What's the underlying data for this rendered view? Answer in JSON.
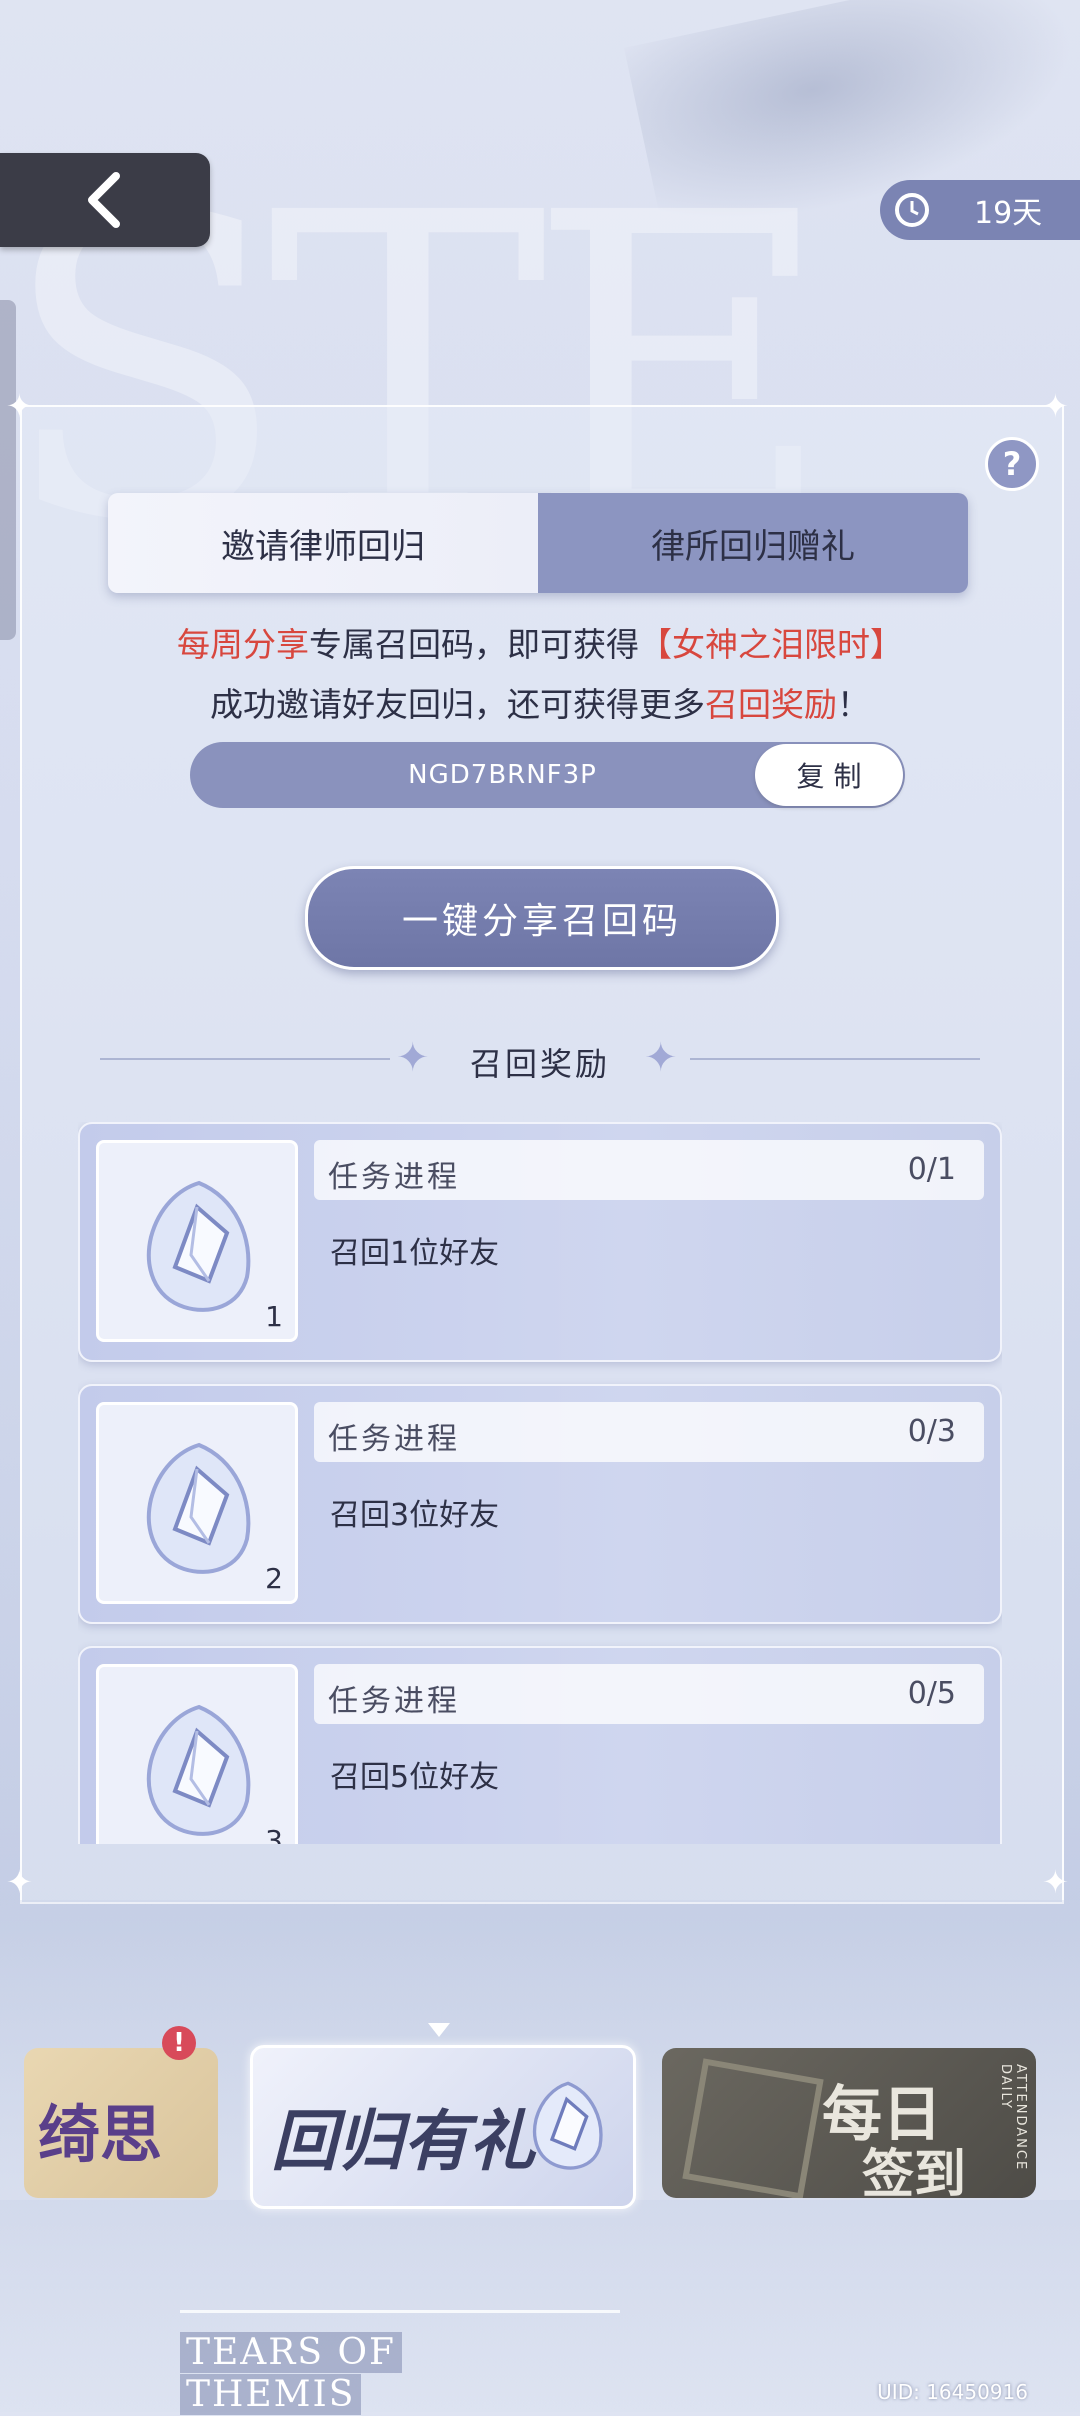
{
  "header": {
    "timer_text": "19天"
  },
  "tabs": [
    {
      "label": "邀请律师回归"
    },
    {
      "label": "律所回归赠礼"
    }
  ],
  "intro": {
    "line1_part1": "每周分享",
    "line1_part2": "专属召回码，即可获得",
    "line1_part3": "【女神之泪限时】",
    "line2_part1": "成功邀请好友回归，还可获得更多",
    "line2_part2": "召回奖励",
    "line2_part3": "！"
  },
  "code": {
    "value": "NGD7BRNF3P",
    "copy_label": "复 制"
  },
  "share_button": "一键分享召回码",
  "section_title": "召回奖励",
  "tasks": [
    {
      "label": "任务进程",
      "progress": "0/1",
      "desc": "召回1位好友",
      "count": "1"
    },
    {
      "label": "任务进程",
      "progress": "0/3",
      "desc": "召回3位好友",
      "count": "2"
    },
    {
      "label": "任务进程",
      "progress": "0/5",
      "desc": "召回5位好友",
      "count": "3"
    }
  ],
  "banners": {
    "b1_text": "绮思",
    "b2_text": "回归有礼",
    "b3_text1": "每日",
    "b3_text2": "签到",
    "b3_side": "ATTENDANCE DAILY"
  },
  "logo": {
    "line1": "TEARS OF",
    "line2": "THEMIS"
  },
  "uid": "UID: 16450916",
  "colors": {
    "accent": "#7b84b3",
    "highlight_red": "#d8473e",
    "dark_button": "#3b3c47"
  }
}
